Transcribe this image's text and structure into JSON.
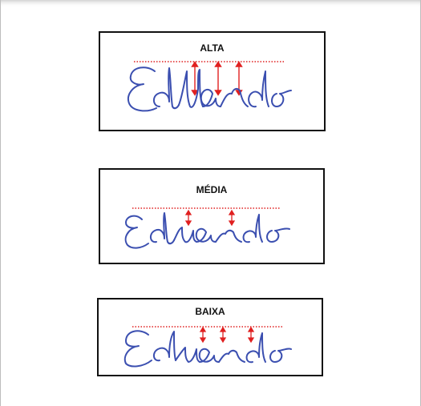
{
  "samples": [
    {
      "heading": "ALTA",
      "word": "Eduardo",
      "level": "alta"
    },
    {
      "heading": "MÉDIA",
      "word": "Eduardo",
      "level": "média"
    },
    {
      "heading": "BAIXA",
      "word": "Eduardo",
      "level": "baixa"
    }
  ],
  "colors": {
    "ink": "#3b4fb0",
    "guideline": "#e02020",
    "arrow": "#e02020",
    "border": "#111111"
  }
}
